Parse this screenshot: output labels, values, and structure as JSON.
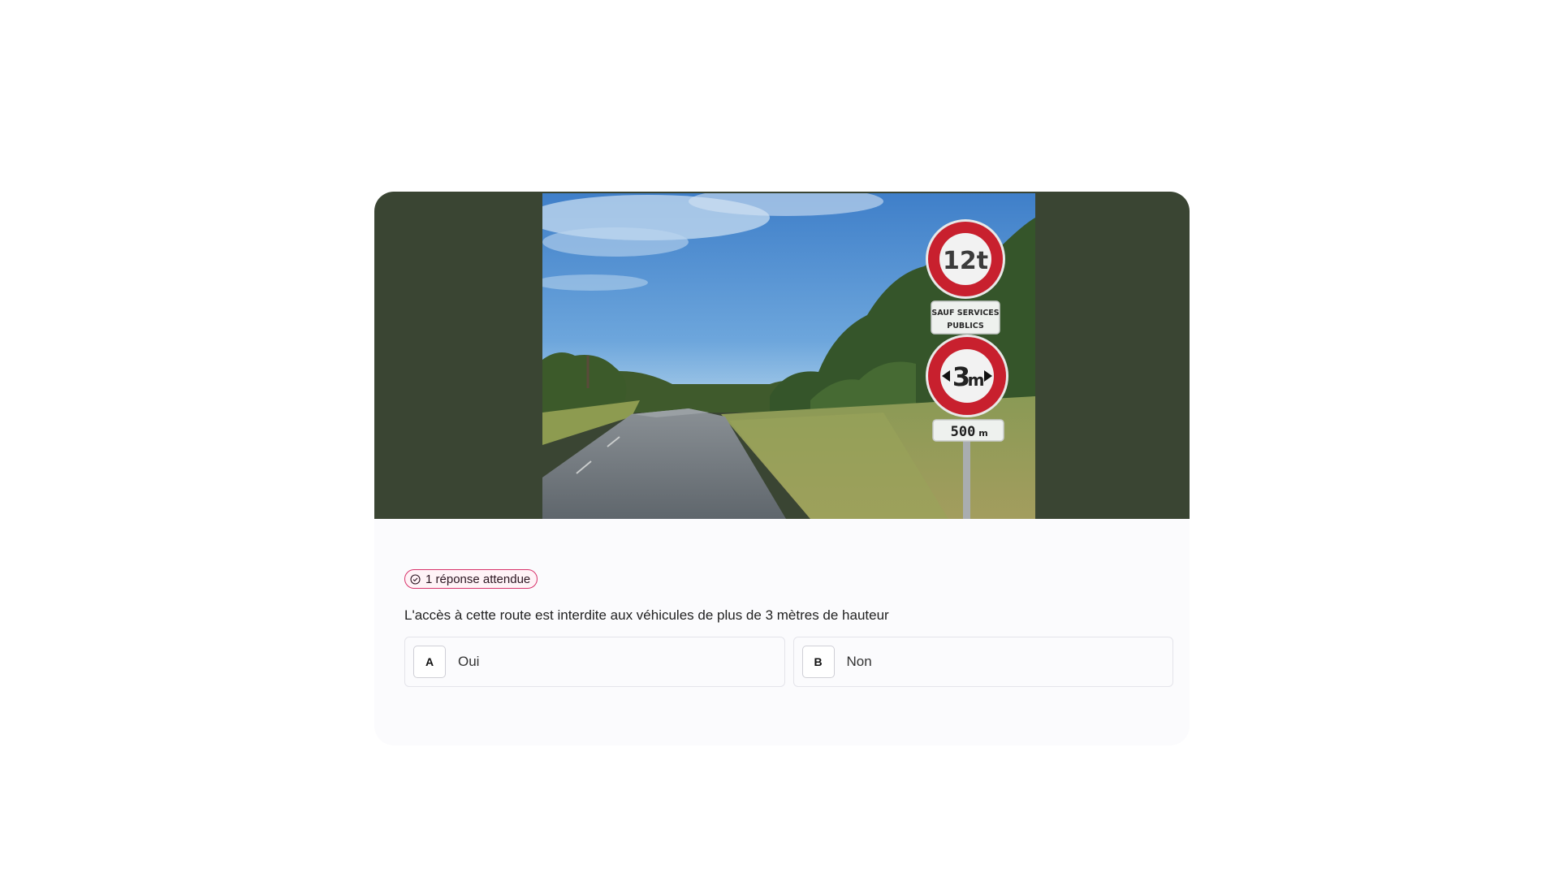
{
  "question_card": {
    "badge": {
      "icon": "check-circle-icon",
      "label": "1 réponse attendue",
      "color": "#d8336b"
    },
    "question": "L'accès à cette route est interdite aux véhicules de plus de 3 mètres de hauteur",
    "answers": [
      {
        "key": "A",
        "label": "Oui"
      },
      {
        "key": "B",
        "label": "Non"
      }
    ],
    "photo": {
      "signs": {
        "weight_limit": "12t",
        "weight_plate_line1": "SAUF SERVICES",
        "weight_plate_line2": "PUBLICS",
        "height_limit_value": "3",
        "height_limit_unit": "m",
        "distance_value": "500",
        "distance_unit": "m"
      }
    },
    "colors": {
      "media_background": "#3a4533",
      "sign_red": "#c8202e"
    }
  }
}
